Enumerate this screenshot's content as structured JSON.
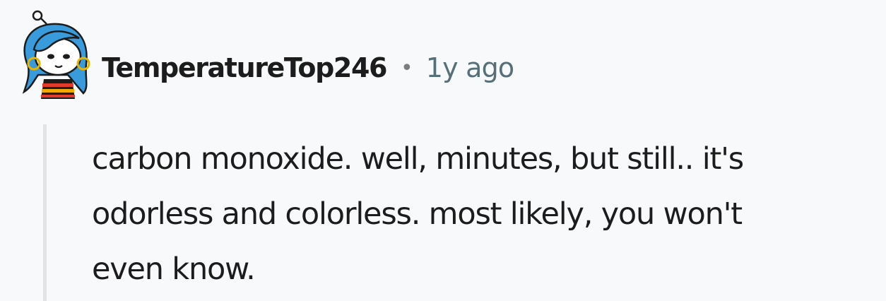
{
  "comment": {
    "author": "TemperatureTop246",
    "separator": "•",
    "age": "1y ago",
    "avatar_icon": "snoo-avatar-icon",
    "body_lines": [
      "carbon monoxide. well, minutes, but still.. it's",
      "odorless and colorless. most likely, you won't",
      "even know."
    ]
  },
  "colors": {
    "background": "#f7f9fa",
    "text": "#1c1c1c",
    "meta_text": "#576f76",
    "thread_line": "#dfe4e7",
    "avatar_hair": "#3a9bdc"
  }
}
